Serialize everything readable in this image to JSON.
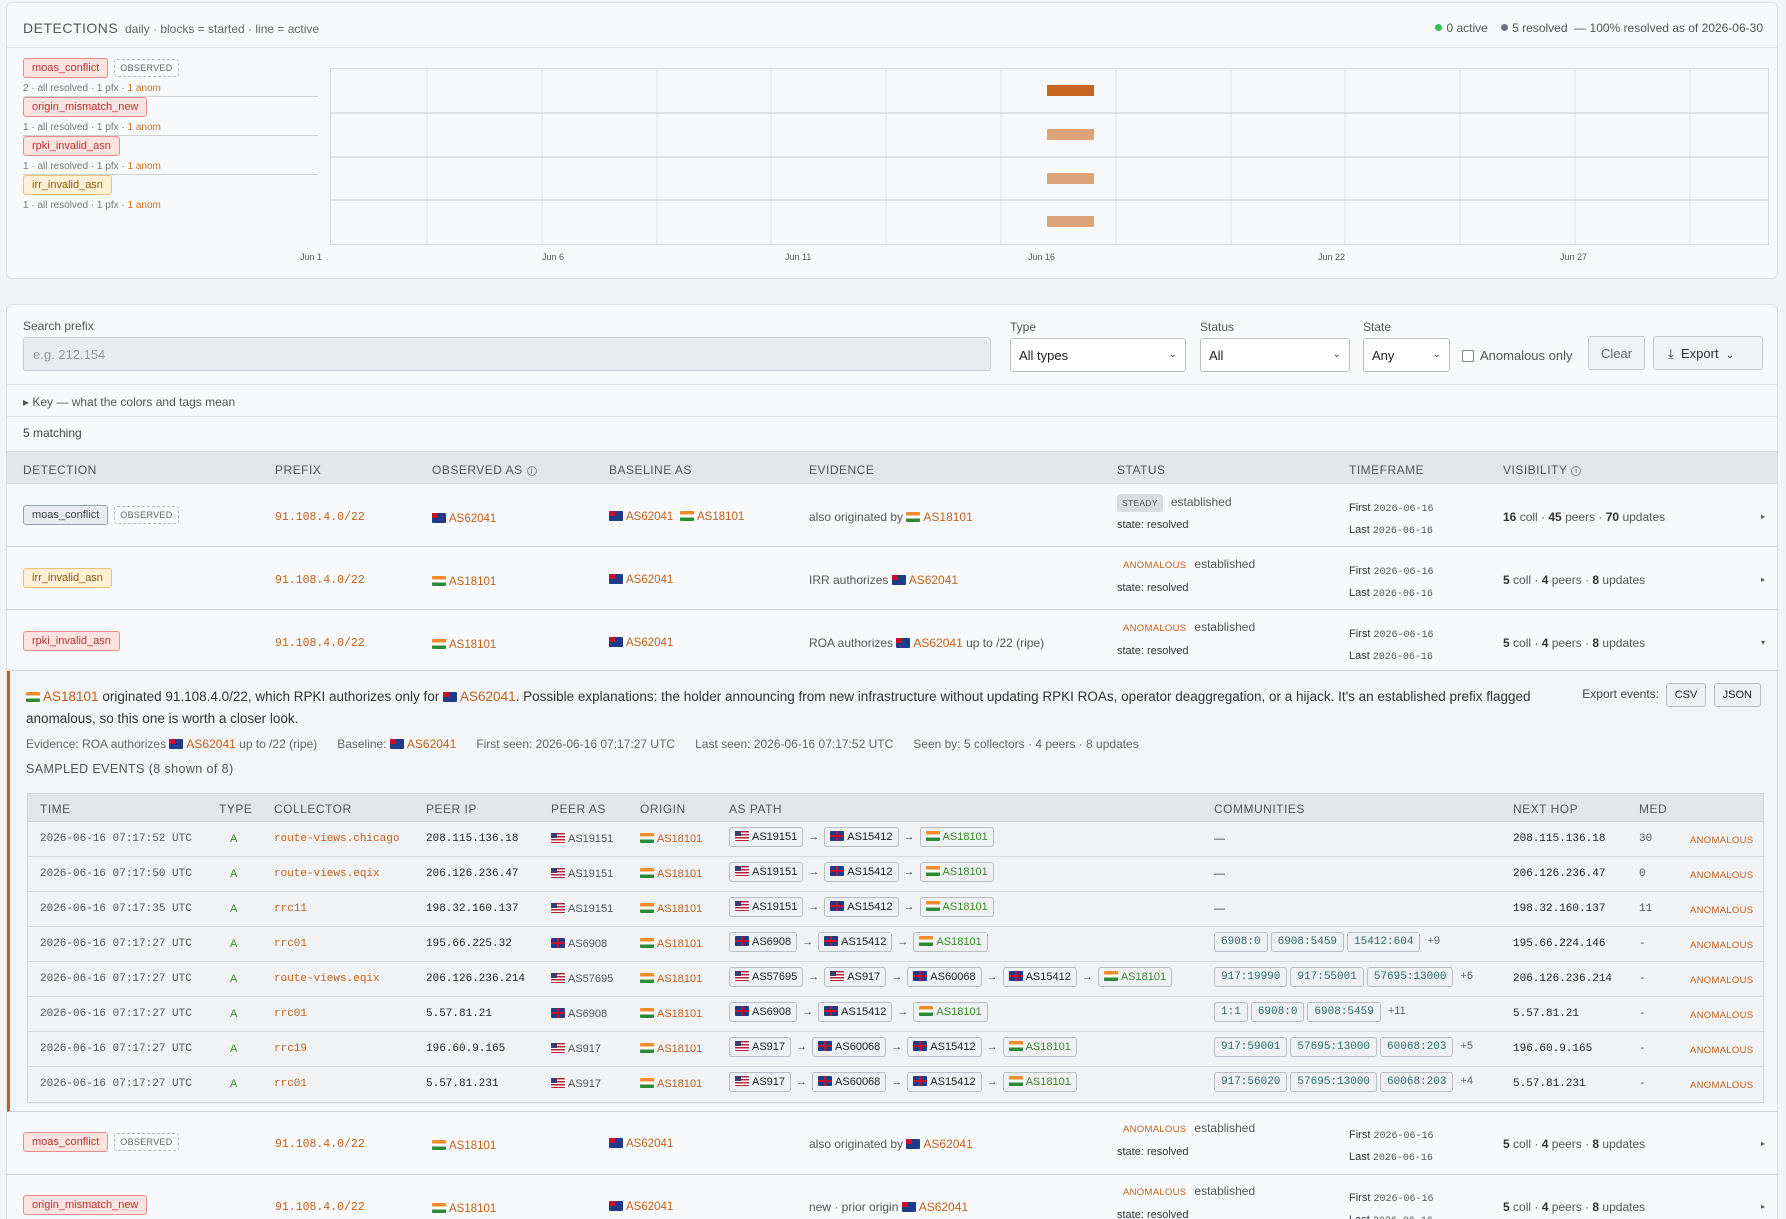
{
  "detections_header": {
    "title": "DETECTIONS",
    "subtitle": "daily · blocks = started · line = active",
    "active_text": "0 active",
    "resolved_text": "5 resolved",
    "summary_text": "— 100% resolved as of 2026-06-30"
  },
  "lanes": [
    {
      "tag": "moas_conflict",
      "tag_color": "red",
      "observed": "OBSERVED",
      "meta_prefix": "2 · all resolved · 1 pfx · ",
      "meta_anom": "1 anom"
    },
    {
      "tag": "origin_mismatch_new",
      "tag_color": "red",
      "observed": "",
      "meta_prefix": "1 · all resolved · 1 pfx · ",
      "meta_anom": "1 anom"
    },
    {
      "tag": "rpki_invalid_asn",
      "tag_color": "red",
      "observed": "",
      "meta_prefix": "1 · all resolved · 1 pfx · ",
      "meta_anom": "1 anom"
    },
    {
      "tag": "irr_invalid_asn",
      "tag_color": "yellow",
      "observed": "",
      "meta_prefix": "1 · all resolved · 1 pfx · ",
      "meta_anom": "1 anom"
    }
  ],
  "timeline_axis": [
    "Jun 1",
    "Jun 6",
    "Jun 11",
    "Jun 16",
    "Jun 22",
    "Jun 27"
  ],
  "timeline_colors": {
    "block_strong": "#c9651e",
    "block_light": "#dca47a"
  },
  "filters": {
    "search_label": "Search prefix",
    "search_placeholder": "e.g. 212.154",
    "type_label": "Type",
    "type_value": "All types",
    "status_label": "Status",
    "status_value": "All",
    "state_label": "State",
    "state_value": "Any",
    "anomalous_only": "Anomalous only",
    "clear": "Clear",
    "export": "Export"
  },
  "key_toggle": "▸ Key — what the colors and tags mean",
  "matching": "5 matching",
  "columns": {
    "detection": "DETECTION",
    "prefix": "PREFIX",
    "observed_as": "OBSERVED AS",
    "baseline_as": "BASELINE AS",
    "evidence": "EVIDENCE",
    "status": "STATUS",
    "timeframe": "TIMEFRAME",
    "visibility": "VISIBILITY"
  },
  "rows": [
    {
      "tag": "moas_conflict",
      "observed": "OBSERVED",
      "prefix": "91.108.4.0/22",
      "observed_as": "AS62041",
      "baseline_as_1": "AS62041",
      "baseline_as_2": "AS18101",
      "evidence_text": "also originated by ",
      "evidence_as": "AS18101",
      "evidence_suffix": "",
      "status_badge": "STEADY",
      "status_text": "established",
      "state": "state: resolved",
      "first_label": "First",
      "first": "2026-06-16",
      "last_label": "Last",
      "last": "2026-06-16",
      "vis_coll": "16",
      "vis_coll_lbl": " coll · ",
      "vis_peers": "45",
      "vis_peers_lbl": " peers · ",
      "vis_updates": "70",
      "vis_updates_lbl": " updates"
    },
    {
      "tag": "irr_invalid_asn",
      "observed": "",
      "prefix": "91.108.4.0/22",
      "observed_as": "AS18101",
      "baseline_as_1": "AS62041",
      "baseline_as_2": "",
      "evidence_text": "IRR authorizes ",
      "evidence_as": "AS62041",
      "evidence_suffix": "",
      "status_badge": "ANOMALOUS",
      "status_text": "established",
      "state": "state: resolved",
      "first_label": "First",
      "first": "2026-06-16",
      "last_label": "Last",
      "last": "2026-06-16",
      "vis_coll": "5",
      "vis_coll_lbl": " coll · ",
      "vis_peers": "4",
      "vis_peers_lbl": " peers · ",
      "vis_updates": "8",
      "vis_updates_lbl": " updates"
    },
    {
      "tag": "rpki_invalid_asn",
      "observed": "",
      "prefix": "91.108.4.0/22",
      "observed_as": "AS18101",
      "baseline_as_1": "AS62041",
      "baseline_as_2": "",
      "evidence_text": "ROA authorizes ",
      "evidence_as": "AS62041",
      "evidence_suffix": " up to /22 (ripe)",
      "status_badge": "ANOMALOUS",
      "status_text": "established",
      "state": "state: resolved",
      "first_label": "First",
      "first": "2026-06-16",
      "last_label": "Last",
      "last": "2026-06-16",
      "vis_coll": "5",
      "vis_coll_lbl": " coll · ",
      "vis_peers": "4",
      "vis_peers_lbl": " peers · ",
      "vis_updates": "8",
      "vis_updates_lbl": " updates"
    },
    {
      "tag": "moas_conflict",
      "observed": "OBSERVED",
      "prefix": "91.108.4.0/22",
      "observed_as": "AS18101",
      "baseline_as_1": "AS62041",
      "baseline_as_2": "",
      "evidence_text": "also originated by ",
      "evidence_as": "AS62041",
      "evidence_suffix": "",
      "status_badge": "ANOMALOUS",
      "status_text": "established",
      "state": "state: resolved",
      "first_label": "First",
      "first": "2026-06-16",
      "last_label": "Last",
      "last": "2026-06-16",
      "vis_coll": "5",
      "vis_coll_lbl": " coll · ",
      "vis_peers": "4",
      "vis_peers_lbl": " peers · ",
      "vis_updates": "8",
      "vis_updates_lbl": " updates"
    },
    {
      "tag": "origin_mismatch_new",
      "observed": "",
      "prefix": "91.108.4.0/22",
      "observed_as": "AS18101",
      "baseline_as_1": "AS62041",
      "baseline_as_2": "",
      "evidence_text": "new · prior origin ",
      "evidence_as": "AS62041",
      "evidence_suffix": "",
      "status_badge": "ANOMALOUS",
      "status_text": "established",
      "state": "state: resolved",
      "first_label": "First",
      "first": "2026-06-16",
      "last_label": "Last",
      "last": "2026-06-16",
      "vis_coll": "5",
      "vis_coll_lbl": " coll · ",
      "vis_peers": "4",
      "vis_peers_lbl": " peers · ",
      "vis_updates": "8",
      "vis_updates_lbl": " updates"
    }
  ],
  "expanded": {
    "origin_as": "AS18101",
    "text_1": " originated 91.108.4.0/22, which RPKI authorizes only for ",
    "auth_as": "AS62041",
    "text_2": ". Possible explanations: the holder announcing from new infrastructure without updating RPKI ROAs, operator deaggregation, or a hijack. It's an established prefix flagged",
    "text_3": "anomalous, so this one is worth a closer look.",
    "export_label": "Export events:",
    "csv": "CSV",
    "json": "JSON",
    "evidence_label": "Evidence: ROA authorizes ",
    "evidence_as": "AS62041",
    "evidence_suffix": " up to /22 (ripe)",
    "baseline_label": "Baseline: ",
    "baseline_as": "AS62041",
    "first_seen": "First seen: 2026-06-16 07:17:27 UTC",
    "last_seen": "Last seen: 2026-06-16 07:17:52 UTC",
    "seen_by": "Seen by: 5 collectors · 4 peers · 8 updates",
    "sampled_title": "SAMPLED EVENTS (8 shown of 8)",
    "event_columns": {
      "time": "TIME",
      "type": "TYPE",
      "collector": "COLLECTOR",
      "peer_ip": "PEER IP",
      "peer_as": "PEER AS",
      "origin": "ORIGIN",
      "as_path": "AS PATH",
      "communities": "COMMUNITIES",
      "next_hop": "NEXT HOP",
      "med": "MED"
    },
    "events": [
      {
        "time": "2026-06-16 07:17:52 UTC",
        "type": "A",
        "collector": "route-views.chicago",
        "peer_ip": "208.115.136.18",
        "peer_as": "AS19151",
        "peer_flag": "us",
        "origin": "AS18101",
        "path": [
          {
            "as": "AS19151",
            "flag": "us"
          },
          {
            "as": "AS15412",
            "flag": "gb"
          },
          {
            "as": "AS18101",
            "flag": "in"
          }
        ],
        "communities": [],
        "comm_empty": "—",
        "comm_more": "",
        "next_hop": "208.115.136.18",
        "med": "30",
        "label": "ANOMALOUS"
      },
      {
        "time": "2026-06-16 07:17:50 UTC",
        "type": "A",
        "collector": "route-views.eqix",
        "peer_ip": "206.126.236.47",
        "peer_as": "AS19151",
        "peer_flag": "us",
        "origin": "AS18101",
        "path": [
          {
            "as": "AS19151",
            "flag": "us"
          },
          {
            "as": "AS15412",
            "flag": "gb"
          },
          {
            "as": "AS18101",
            "flag": "in"
          }
        ],
        "communities": [],
        "comm_empty": "—",
        "comm_more": "",
        "next_hop": "206.126.236.47",
        "med": "0",
        "label": "ANOMALOUS"
      },
      {
        "time": "2026-06-16 07:17:35 UTC",
        "type": "A",
        "collector": "rrc11",
        "peer_ip": "198.32.160.137",
        "peer_as": "AS19151",
        "peer_flag": "us",
        "origin": "AS18101",
        "path": [
          {
            "as": "AS19151",
            "flag": "us"
          },
          {
            "as": "AS15412",
            "flag": "gb"
          },
          {
            "as": "AS18101",
            "flag": "in"
          }
        ],
        "communities": [],
        "comm_empty": "—",
        "comm_more": "",
        "next_hop": "198.32.160.137",
        "med": "11",
        "label": "ANOMALOUS"
      },
      {
        "time": "2026-06-16 07:17:27 UTC",
        "type": "A",
        "collector": "rrc01",
        "peer_ip": "195.66.225.32",
        "peer_as": "AS6908",
        "peer_flag": "gb",
        "origin": "AS18101",
        "path": [
          {
            "as": "AS6908",
            "flag": "gb"
          },
          {
            "as": "AS15412",
            "flag": "gb"
          },
          {
            "as": "AS18101",
            "flag": "in"
          }
        ],
        "communities": [
          "6908:0",
          "6908:5459",
          "15412:604"
        ],
        "comm_empty": "",
        "comm_more": "+9",
        "next_hop": "195.66.224.146",
        "med": "-",
        "label": "ANOMALOUS"
      },
      {
        "time": "2026-06-16 07:17:27 UTC",
        "type": "A",
        "collector": "route-views.eqix",
        "peer_ip": "206.126.236.214",
        "peer_as": "AS57695",
        "peer_flag": "us",
        "origin": "AS18101",
        "path": [
          {
            "as": "AS57695",
            "flag": "us"
          },
          {
            "as": "AS917",
            "flag": "us"
          },
          {
            "as": "AS60068",
            "flag": "gb"
          },
          {
            "as": "AS15412",
            "flag": "gb"
          },
          {
            "as": "AS18101",
            "flag": "in"
          }
        ],
        "communities": [
          "917:19990",
          "917:55001",
          "57695:13000"
        ],
        "comm_empty": "",
        "comm_more": "+6",
        "next_hop": "206.126.236.214",
        "med": "-",
        "label": "ANOMALOUS"
      },
      {
        "time": "2026-06-16 07:17:27 UTC",
        "type": "A",
        "collector": "rrc01",
        "peer_ip": "5.57.81.21",
        "peer_as": "AS6908",
        "peer_flag": "gb",
        "origin": "AS18101",
        "path": [
          {
            "as": "AS6908",
            "flag": "gb"
          },
          {
            "as": "AS15412",
            "flag": "gb"
          },
          {
            "as": "AS18101",
            "flag": "in"
          }
        ],
        "communities": [
          "1:1",
          "6908:0",
          "6908:5459"
        ],
        "comm_empty": "",
        "comm_more": "+11",
        "next_hop": "5.57.81.21",
        "med": "-",
        "label": "ANOMALOUS"
      },
      {
        "time": "2026-06-16 07:17:27 UTC",
        "type": "A",
        "collector": "rrc19",
        "peer_ip": "196.60.9.165",
        "peer_as": "AS917",
        "peer_flag": "us",
        "origin": "AS18101",
        "path": [
          {
            "as": "AS917",
            "flag": "us"
          },
          {
            "as": "AS60068",
            "flag": "gb"
          },
          {
            "as": "AS15412",
            "flag": "gb"
          },
          {
            "as": "AS18101",
            "flag": "in"
          }
        ],
        "communities": [
          "917:59001",
          "57695:13000",
          "60068:203"
        ],
        "comm_empty": "",
        "comm_more": "+5",
        "next_hop": "196.60.9.165",
        "med": "-",
        "label": "ANOMALOUS"
      },
      {
        "time": "2026-06-16 07:17:27 UTC",
        "type": "A",
        "collector": "rrc01",
        "peer_ip": "5.57.81.231",
        "peer_as": "AS917",
        "peer_flag": "us",
        "origin": "AS18101",
        "path": [
          {
            "as": "AS917",
            "flag": "us"
          },
          {
            "as": "AS60068",
            "flag": "gb"
          },
          {
            "as": "AS15412",
            "flag": "gb"
          },
          {
            "as": "AS18101",
            "flag": "in"
          }
        ],
        "communities": [
          "917:56020",
          "57695:13000",
          "60068:203"
        ],
        "comm_empty": "",
        "comm_more": "+4",
        "next_hop": "5.57.81.231",
        "med": "-",
        "label": "ANOMALOUS"
      }
    ]
  }
}
